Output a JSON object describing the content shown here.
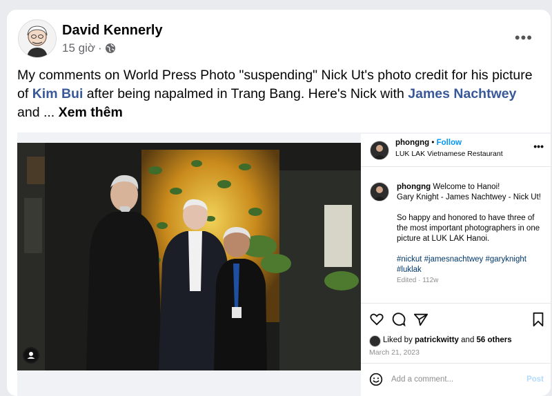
{
  "post": {
    "author": "David Kennerly",
    "time": "15 giờ",
    "separator": "·",
    "text_1": "My comments on World Press Photo \"suspending\" Nick Ut's photo credit for his picture of ",
    "link_1": "Kim Bui",
    "text_2": " after being napalmed in Trang Bang. Here's Nick with ",
    "link_2": "James Nachtwey",
    "text_3": " and ... ",
    "see_more": "Xem thêm",
    "more_icon": "more-horizontal-icon",
    "privacy_icon": "globe-icon"
  },
  "instagram": {
    "username": "phongng",
    "dot": "•",
    "follow": "Follow",
    "location": "LUK LAK Vietnamese Restaurant",
    "caption_user": "phongng",
    "caption_line1": " Welcome to Hanoi!",
    "caption_line2": "Gary Knight - James Nachtwey - Nick Ut!",
    "caption_para2": "So happy and honored to have three of the most important photographers in one picture at LUK LAK Hanoi.",
    "hashtags": "#nickut #jamesnachtwey #garyknight #luklak",
    "edited": "Edited · 112w",
    "liked_by_prefix": "Liked by ",
    "liked_by_user": "patrickwitty",
    "liked_by_and": " and ",
    "liked_by_others": "56 others",
    "date": "March 21, 2023",
    "comment_placeholder": "Add a comment...",
    "post_button": "Post",
    "icons": [
      "heart-icon",
      "comment-icon",
      "share-icon",
      "bookmark-icon",
      "emoji-icon",
      "more-horizontal-icon",
      "user-tag-icon"
    ]
  }
}
